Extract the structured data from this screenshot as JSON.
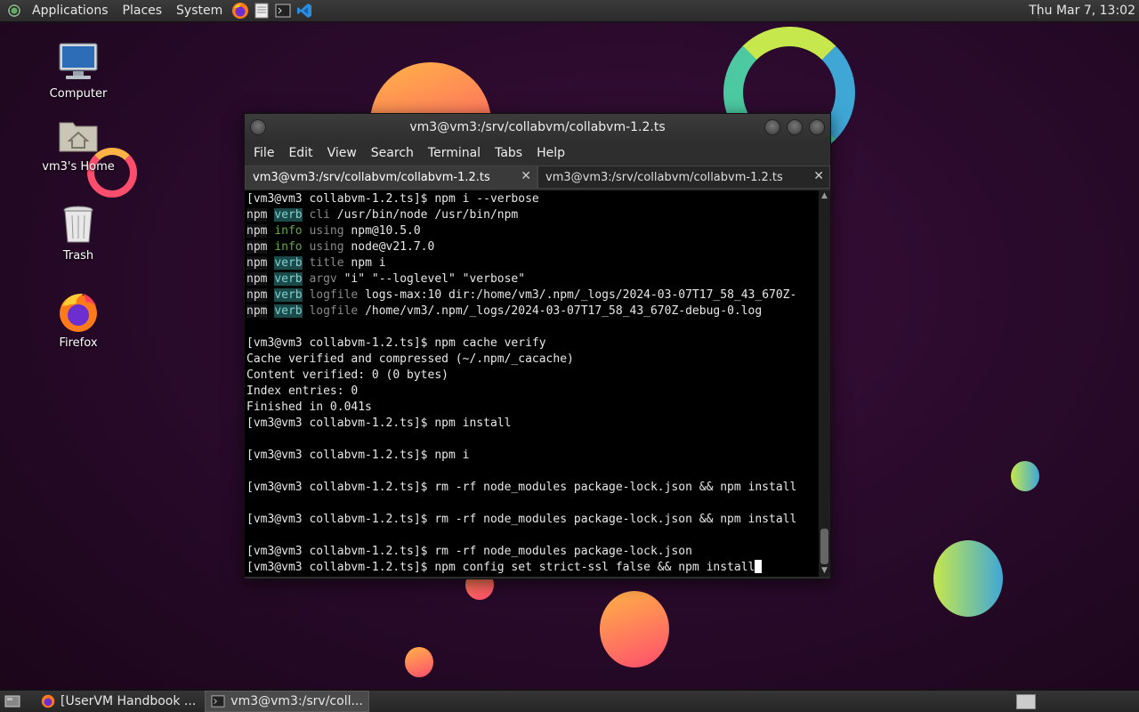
{
  "top_panel": {
    "menus": [
      "Applications",
      "Places",
      "System"
    ],
    "clock": "Thu Mar  7, 13:02"
  },
  "desktop_icons": [
    {
      "label": "Computer",
      "icon": "computer-icon"
    },
    {
      "label": "vm3's Home",
      "icon": "home-folder-icon"
    },
    {
      "label": "Trash",
      "icon": "trash-icon"
    },
    {
      "label": "Firefox",
      "icon": "firefox-icon"
    }
  ],
  "window": {
    "title": "vm3@vm3:/srv/collabvm/collabvm-1.2.ts",
    "menu": [
      "File",
      "Edit",
      "View",
      "Search",
      "Terminal",
      "Tabs",
      "Help"
    ],
    "tabs": [
      {
        "label": "vm3@vm3:/srv/collabvm/collabvm-1.2.ts",
        "active": true
      },
      {
        "label": "vm3@vm3:/srv/collabvm/collabvm-1.2.ts",
        "active": false
      }
    ]
  },
  "terminal": {
    "prompt": "[vm3@vm3 collabvm-1.2.ts]$ ",
    "lines": [
      {
        "type": "cmd",
        "text": "npm i --verbose"
      },
      {
        "type": "log",
        "tag": "verb",
        "key": "cli",
        "text": "/usr/bin/node /usr/bin/npm"
      },
      {
        "type": "log",
        "tag": "info",
        "key": "using",
        "text": "npm@10.5.0"
      },
      {
        "type": "log",
        "tag": "info",
        "key": "using",
        "text": "node@v21.7.0"
      },
      {
        "type": "log",
        "tag": "verb",
        "key": "title",
        "text": "npm i"
      },
      {
        "type": "log",
        "tag": "verb",
        "key": "argv",
        "text": "\"i\" \"--loglevel\" \"verbose\""
      },
      {
        "type": "log",
        "tag": "verb",
        "key": "logfile",
        "text": "logs-max:10 dir:/home/vm3/.npm/_logs/2024-03-07T17_58_43_670Z-"
      },
      {
        "type": "log",
        "tag": "verb",
        "key": "logfile",
        "text": "/home/vm3/.npm/_logs/2024-03-07T17_58_43_670Z-debug-0.log"
      },
      {
        "type": "blank"
      },
      {
        "type": "cmd",
        "text": "npm cache verify"
      },
      {
        "type": "out",
        "text": "Cache verified and compressed (~/.npm/_cacache)"
      },
      {
        "type": "out",
        "text": "Content verified: 0 (0 bytes)"
      },
      {
        "type": "out",
        "text": "Index entries: 0"
      },
      {
        "type": "out",
        "text": "Finished in 0.041s"
      },
      {
        "type": "cmd",
        "text": "npm install"
      },
      {
        "type": "blank"
      },
      {
        "type": "cmd",
        "text": "npm i"
      },
      {
        "type": "blank"
      },
      {
        "type": "cmd",
        "text": "rm -rf node_modules package-lock.json && npm install"
      },
      {
        "type": "blank"
      },
      {
        "type": "cmd",
        "text": "rm -rf node_modules package-lock.json && npm install"
      },
      {
        "type": "blank"
      },
      {
        "type": "cmd",
        "text": "rm -rf node_modules package-lock.json"
      },
      {
        "type": "cmd",
        "text": "npm config set strict-ssl false && npm install",
        "cursor": true
      }
    ]
  },
  "taskbar": {
    "tasks": [
      {
        "label": "[UserVM Handbook ...",
        "icon": "firefox-icon",
        "active": false
      },
      {
        "label": "vm3@vm3:/srv/coll...",
        "icon": "terminal-icon",
        "active": true
      }
    ]
  },
  "colors": {
    "verb_bg": "#1b4a4a",
    "info_fg": "#5fae3f"
  }
}
